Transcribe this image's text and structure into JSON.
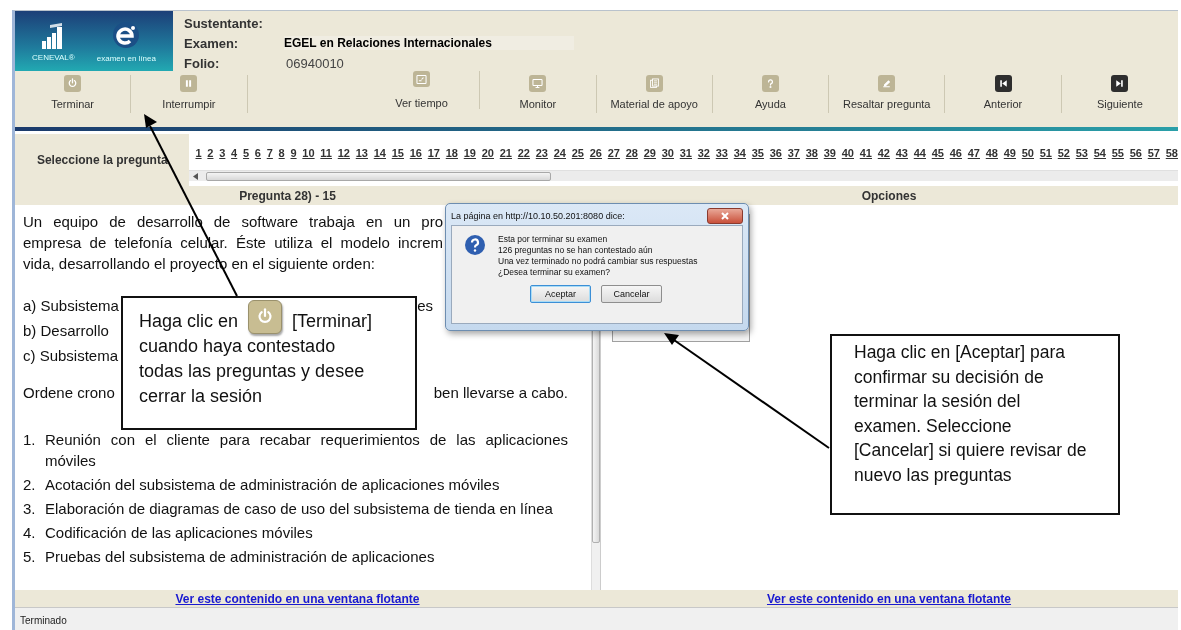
{
  "header": {
    "logo_captions": [
      "CENEVAL®",
      "examen en línea"
    ],
    "fields": [
      {
        "label": "Sustentante:"
      },
      {
        "label": "Examen:",
        "value": "EGEL en Relaciones Internacionales"
      },
      {
        "label": "Folio:",
        "value": "06940010"
      }
    ]
  },
  "toolbar_groups": [
    [
      {
        "label": "Terminar"
      },
      {
        "label": "Interrumpir"
      }
    ],
    [
      {
        "label": "Ver tiempo"
      },
      {
        "label": "Monitor"
      },
      {
        "label": "Material de apoyo"
      },
      {
        "label": "Ayuda"
      },
      {
        "label": "Resaltar pregunta"
      },
      {
        "label": "Anterior"
      },
      {
        "label": "Siguiente"
      }
    ]
  ],
  "question_picker": {
    "label": "Seleccione la pregunta",
    "numbers": [
      "1",
      "2",
      "3",
      "4",
      "5",
      "6",
      "7",
      "8",
      "9",
      "10",
      "11",
      "12",
      "13",
      "14",
      "15",
      "16",
      "17",
      "18",
      "19",
      "20",
      "21",
      "22",
      "23",
      "24",
      "25",
      "26",
      "27",
      "28",
      "29",
      "30",
      "31",
      "32",
      "33",
      "34",
      "35",
      "36",
      "37",
      "38",
      "39",
      "40",
      "41",
      "42",
      "43",
      "44",
      "45",
      "46",
      "47",
      "48",
      "49",
      "50",
      "51",
      "52",
      "53",
      "54",
      "55",
      "56",
      "57",
      "58"
    ]
  },
  "question_pane": {
    "title": "Pregunta 28) - 15",
    "intro_lines": [
      "Un equipo de desarrollo de software trabaja en un pro",
      "empresa de telefonía celular. Éste utiliza el modelo increm",
      "vida, desarrollando el proyecto en el siguiente orden:"
    ],
    "options": [
      {
        "left": "a) Subsistema",
        "right": "es"
      },
      {
        "left": "b) Desarrollo"
      },
      {
        "left": "c) Subsistema"
      }
    ],
    "instruction": {
      "left": "Ordene crono",
      "right": "ben llevarse a cabo."
    },
    "steps": [
      {
        "number": "1.",
        "text": "Reunión con el cliente para recabar requerimientos de las aplicaciones móviles"
      },
      {
        "number": "2.",
        "text": "Acotación del subsistema de administración de aplicaciones móviles"
      },
      {
        "number": "3.",
        "text": "Elaboración de diagramas de caso de uso del subsistema de tienda en línea"
      },
      {
        "number": "4.",
        "text": "Codificación de las aplicaciones móviles"
      },
      {
        "number": "5.",
        "text": "Pruebas del subsistema de administración de aplicaciones"
      }
    ],
    "link": "Ver este contenido en una ventana flotante"
  },
  "options_pane": {
    "title": "Opciones",
    "link": "Ver este contenido en una ventana flotante"
  },
  "status_bar": "Terminado",
  "dialog": {
    "title": "La página en http://10.10.50.201:8080 dice:",
    "lines": [
      "Esta por terminar su examen",
      "126 preguntas no se han contestado aún",
      "Una vez terminado no podrá cambiar sus respuestas",
      "¿Desea terminar su examen?"
    ],
    "buttons": [
      {
        "label": "Aceptar",
        "focused": true
      },
      {
        "label": "Cancelar",
        "focused": false
      }
    ]
  },
  "callouts": [
    {
      "before_icon": "Haga clic en",
      "after_icon": "[Terminar]",
      "text": "cuando haya contestado todas las preguntas y desee cerrar la sesión"
    },
    {
      "text": "Haga clic en [Aceptar] para confirmar su decisión de terminar la sesión del examen. Seleccione [Cancelar] si quiere revisar de nuevo las preguntas"
    }
  ]
}
